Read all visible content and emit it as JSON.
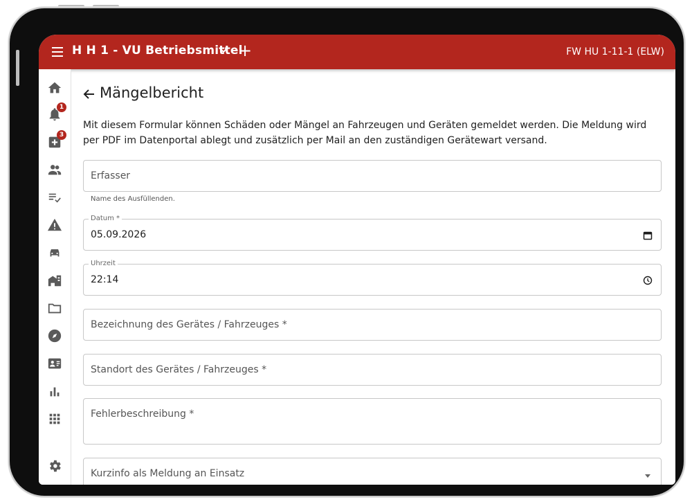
{
  "appbar": {
    "title": "H H 1 - VU Betriebsmittel",
    "unit": "FW HU 1-11-1 (ELW)",
    "bg_color": "#b3261e"
  },
  "sidenav": {
    "items": [
      {
        "icon": "home-icon"
      },
      {
        "icon": "bell-icon",
        "badge": "1"
      },
      {
        "icon": "medical-plus-icon",
        "badge": "3"
      },
      {
        "icon": "people-icon"
      },
      {
        "icon": "checklist-icon"
      },
      {
        "icon": "warning-icon"
      },
      {
        "icon": "car-icon"
      },
      {
        "icon": "building-icon"
      },
      {
        "icon": "folder-icon"
      },
      {
        "icon": "compass-icon"
      },
      {
        "icon": "contact-card-icon"
      },
      {
        "icon": "bar-chart-icon"
      },
      {
        "icon": "apps-grid-icon"
      },
      {
        "icon": "settings-icon"
      }
    ]
  },
  "page": {
    "title": "Mängelbericht",
    "description": "Mit diesem Formular können Schäden oder Mängel an Fahrzeugen und Geräten gemeldet werden. Die Meldung wird per PDF im Datenportal ablegt und zusätzlich per Mail an den zuständigen Gerätewart versand."
  },
  "form": {
    "erfasser": {
      "placeholder": "Erfasser",
      "helper": "Name des Ausfüllenden."
    },
    "datum": {
      "label": "Datum *",
      "value": "05.09.2026"
    },
    "uhrzeit": {
      "label": "Uhrzeit",
      "value": "22:14"
    },
    "bezeichnung": {
      "placeholder": "Bezeichnung des Gerätes / Fahrzeuges *"
    },
    "standort": {
      "placeholder": "Standort des Gerätes / Fahrzeuges *"
    },
    "fehler": {
      "placeholder": "Fehlerbeschreibung *"
    },
    "kurzinfo": {
      "placeholder": "Kurzinfo als Meldung an Einsatz"
    }
  }
}
